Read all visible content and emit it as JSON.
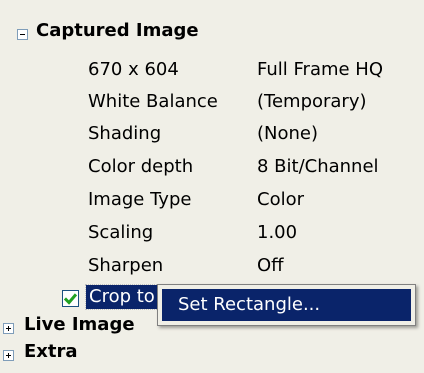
{
  "groups": {
    "captured": {
      "label": "Captured Image",
      "expanded": true
    },
    "live": {
      "label": "Live Image",
      "expanded": false
    },
    "extra": {
      "label": "Extra",
      "expanded": false
    }
  },
  "properties": [
    {
      "name": "670 x 604",
      "value": "Full Frame HQ"
    },
    {
      "name": "White Balance",
      "value": "(Temporary)"
    },
    {
      "name": "Shading",
      "value": "(None)"
    },
    {
      "name": "Color depth",
      "value": "8 Bit/Channel"
    },
    {
      "name": "Image Type",
      "value": "Color"
    },
    {
      "name": "Scaling",
      "value": "1.00"
    },
    {
      "name": "Sharpen",
      "value": "Off"
    }
  ],
  "crop": {
    "label": "Crop to ROI",
    "checked": true
  },
  "context_menu": {
    "item": "Set Rectangle..."
  },
  "colors": {
    "selection": "#0a246a",
    "checkmark": "#21a121",
    "background": "#f0efe7"
  }
}
